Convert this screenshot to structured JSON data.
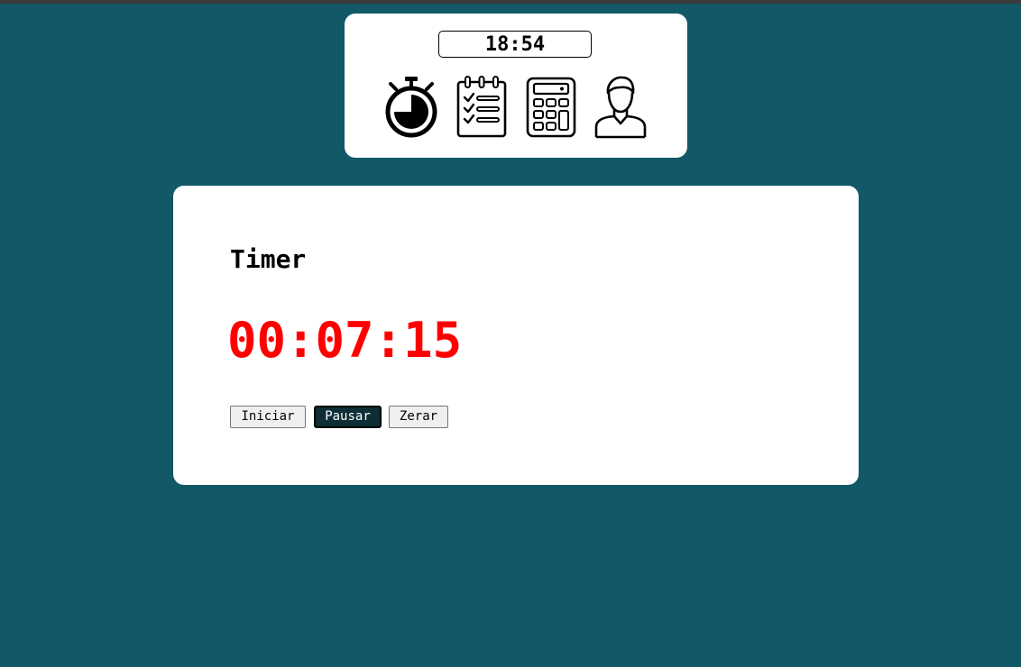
{
  "nav": {
    "clock": "18:54",
    "icons": [
      "stopwatch-icon",
      "checklist-icon",
      "calculator-icon",
      "user-icon"
    ]
  },
  "timer": {
    "title": "Timer",
    "display": "00:07:15",
    "buttons": {
      "start": "Iniciar",
      "pause": "Pausar",
      "reset": "Zerar"
    }
  },
  "colors": {
    "background": "#125867",
    "card": "#ffffff",
    "time": "#ff0000",
    "active_button": "#0e2e36"
  }
}
